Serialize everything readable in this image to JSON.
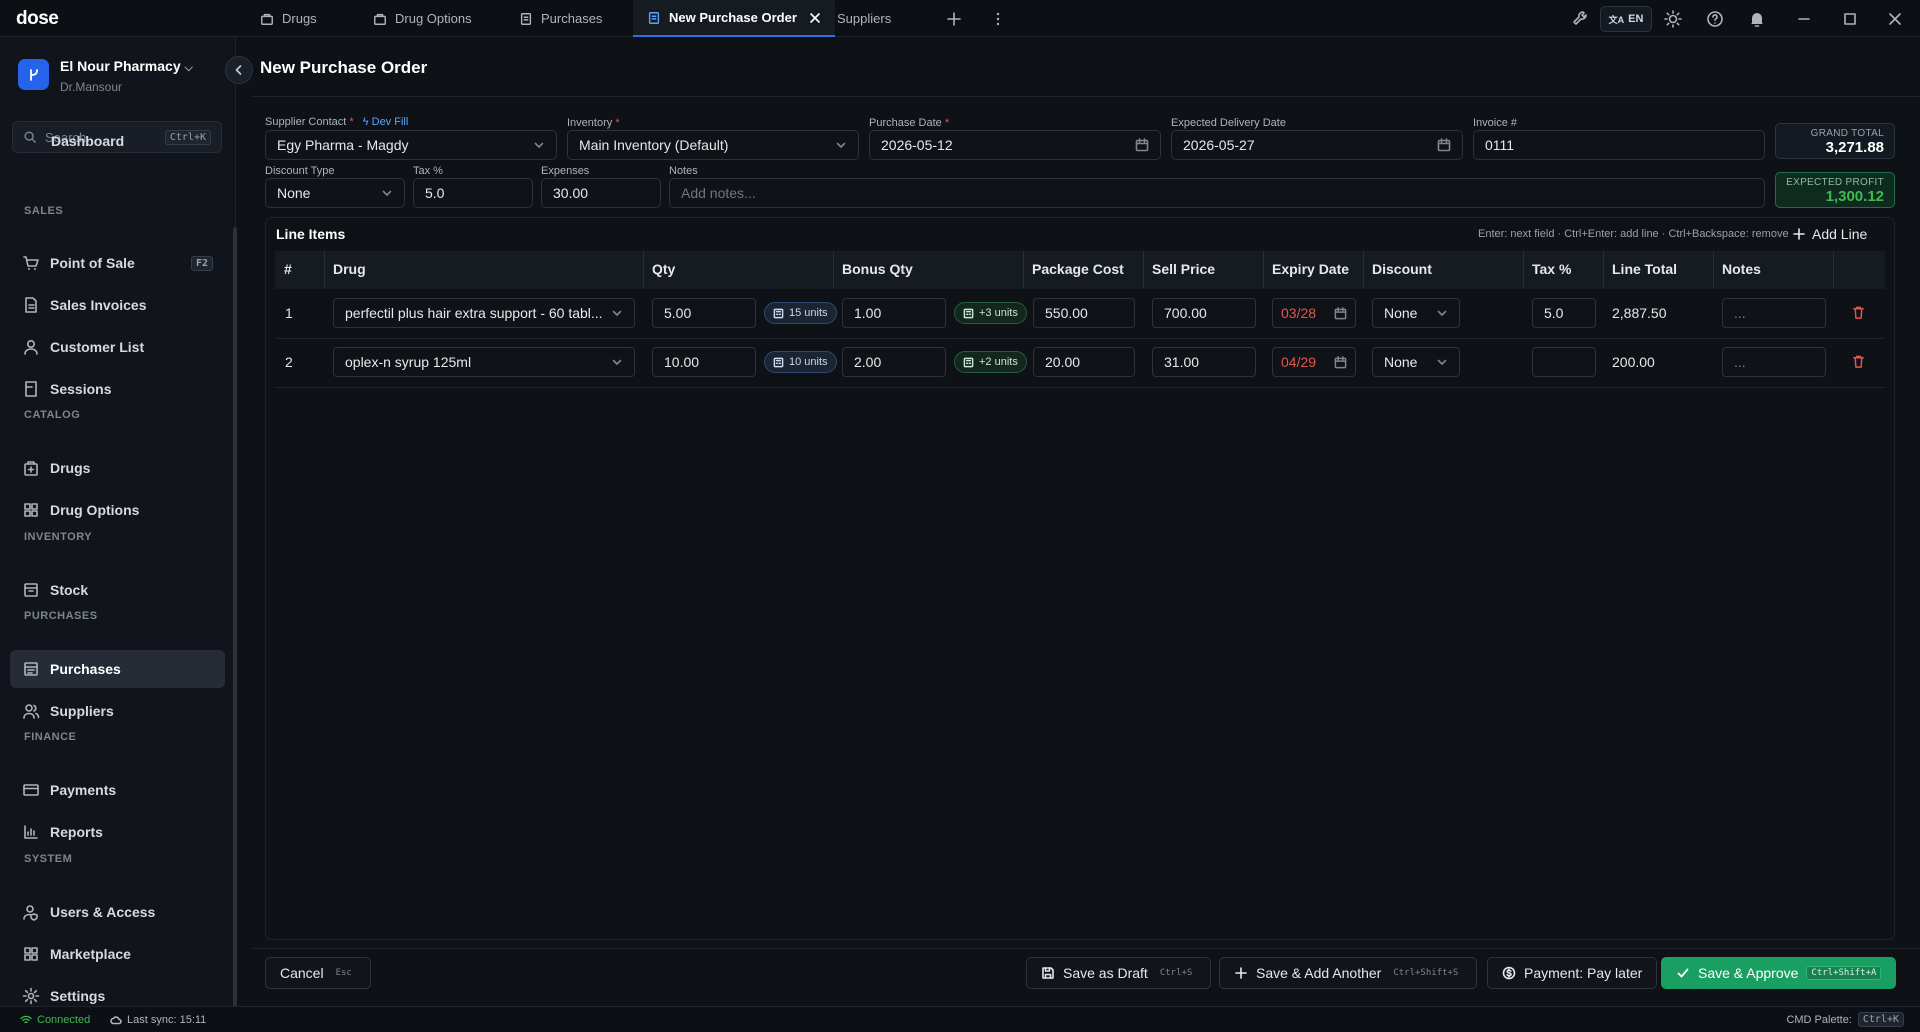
{
  "app": {
    "logo": "dose"
  },
  "tabs": [
    {
      "label": "Drugs"
    },
    {
      "label": "Drug Options"
    },
    {
      "label": "Purchases"
    },
    {
      "label": "New Purchase Order"
    },
    {
      "label": "Suppliers"
    }
  ],
  "titlebar": {
    "lang": "EN"
  },
  "sidebar": {
    "org_name": "El Nour Pharmacy",
    "org_sub": "Dr.Mansour",
    "search_placeholder": "Search...",
    "search_kbd": "Ctrl+K",
    "partial_item": "Dashboard",
    "sections": {
      "sales": "SALES",
      "catalog": "CATALOG",
      "inventory": "INVENTORY",
      "purchases": "PURCHASES",
      "finance": "FINANCE",
      "system": "SYSTEM"
    },
    "items": {
      "pos": "Point of Sale",
      "pos_kbd": "F2",
      "sales_invoices": "Sales Invoices",
      "customer_list": "Customer List",
      "sessions": "Sessions",
      "drugs": "Drugs",
      "drug_options": "Drug Options",
      "stock": "Stock",
      "purchases": "Purchases",
      "suppliers": "Suppliers",
      "payments": "Payments",
      "reports": "Reports",
      "users": "Users & Access",
      "marketplace": "Marketplace",
      "settings": "Settings"
    }
  },
  "page": {
    "title": "New Purchase Order"
  },
  "form": {
    "supplier_label": "Supplier Contact",
    "dev_fill": "Dev Fill",
    "supplier_value": "Egy Pharma - Magdy",
    "inventory_label": "Inventory",
    "inventory_value": "Main Inventory (Default)",
    "purchase_date_label": "Purchase Date",
    "purchase_date_value": "2026-05-12",
    "delivery_label": "Expected Delivery Date",
    "delivery_value": "2026-05-27",
    "invoice_label": "Invoice #",
    "invoice_value": "0111",
    "discount_type_label": "Discount Type",
    "discount_type_value": "None",
    "tax_label": "Tax %",
    "tax_value": "5.0",
    "expenses_label": "Expenses",
    "expenses_value": "30.00",
    "notes_label": "Notes",
    "notes_placeholder": "Add notes...",
    "required_mark": "*"
  },
  "totals": {
    "grand_label": "GRAND TOTAL",
    "grand_value": "3,271.88",
    "profit_label": "EXPECTED PROFIT",
    "profit_value": "1,300.12"
  },
  "line_items": {
    "title": "Line Items",
    "hint": "Enter: next field · Ctrl+Enter: add line · Ctrl+Backspace: remove",
    "add_line": "Add Line",
    "headers": {
      "num": "#",
      "drug": "Drug",
      "qty": "Qty",
      "bonus": "Bonus Qty",
      "cost": "Package Cost",
      "sell": "Sell Price",
      "expiry": "Expiry Date",
      "discount": "Discount",
      "tax": "Tax %",
      "total": "Line Total",
      "notes": "Notes"
    },
    "rows": [
      {
        "num": "1",
        "drug": "perfectil plus hair extra support - 60 tabl...",
        "qty": "5.00",
        "qty_units": "15 units",
        "bonus": "1.00",
        "bonus_units": "+3 units",
        "cost": "550.00",
        "sell": "700.00",
        "expiry": "03/28",
        "discount": "None",
        "tax": "5.0",
        "total": "2,887.50",
        "notes": "..."
      },
      {
        "num": "2",
        "drug": "oplex-n syrup 125ml",
        "qty": "10.00",
        "qty_units": "10 units",
        "bonus": "2.00",
        "bonus_units": "+2 units",
        "cost": "20.00",
        "sell": "31.00",
        "expiry": "04/29",
        "discount": "None",
        "tax": "",
        "total": "200.00",
        "notes": "..."
      }
    ]
  },
  "footer": {
    "cancel": "Cancel",
    "cancel_kbd": "Esc",
    "draft": "Save as Draft",
    "draft_kbd": "Ctrl+S",
    "add_another": "Save & Add Another",
    "add_another_kbd": "Ctrl+Shift+S",
    "payment": "Payment: Pay later",
    "approve": "Save & Approve",
    "approve_kbd": "Ctrl+Shift+A"
  },
  "status": {
    "connected": "Connected",
    "last_sync": "Last sync: 15:11",
    "cmd_label": "CMD Palette:",
    "cmd_kbd": "Ctrl+K"
  },
  "colors": {
    "accent_blue": "#2563eb",
    "approve_green": "#1a9f62",
    "profit_green": "#3fb950",
    "danger_red": "#e5534b",
    "background": "#0e1116"
  }
}
